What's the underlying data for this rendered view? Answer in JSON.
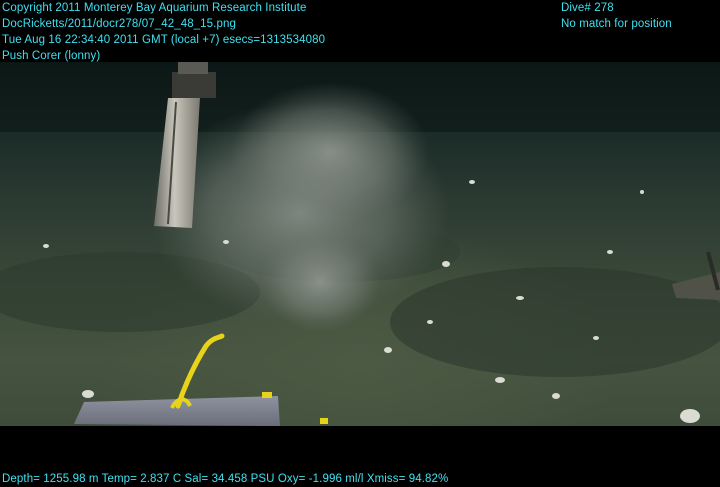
{
  "overlay": {
    "copyright": "Copyright 2011 Monterey Bay Aquarium Research Institute",
    "file_path": "DocRicketts/2011/docr278/07_42_48_15.png",
    "timestamp": "Tue Aug 16 22:34:40 2011 GMT (local +7)  esecs=1313534080",
    "activity": "Push Corer (lonny)",
    "dive": "Dive# 278",
    "position_status": "No match for position",
    "sensor_line": "Depth= 1255.98 m  Temp= 2.837 C  Sal= 34.458 PSU  Oxy= -1.996 ml/l  Xmiss= 94.82%"
  },
  "colors": {
    "overlay_text": "#3fe0f0",
    "letterbox": "#000000",
    "seafloor": "#3a4838",
    "sediment_cloud": "#8a9088",
    "tether": "#e8d21a"
  }
}
